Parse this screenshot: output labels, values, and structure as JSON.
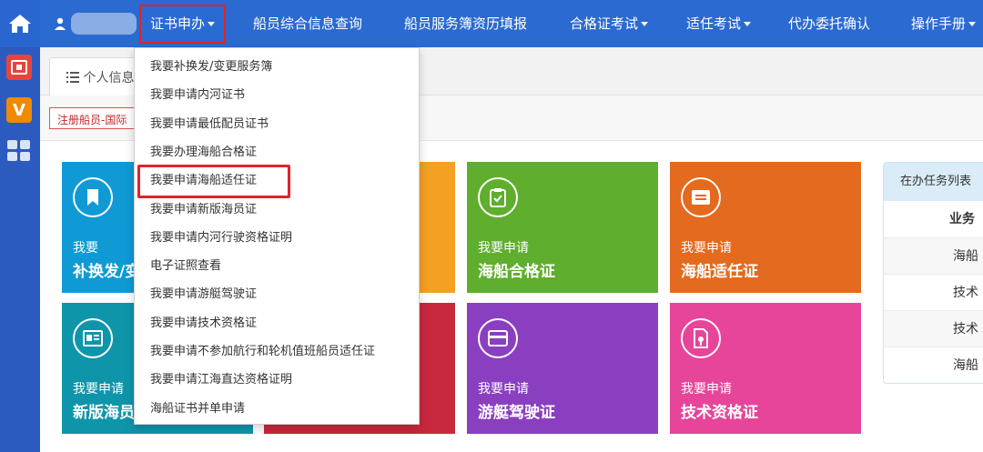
{
  "nav": {
    "items": [
      {
        "label": "证书申办",
        "caret": true
      },
      {
        "label": "船员综合信息查询",
        "caret": false
      },
      {
        "label": "船员服务簿资历填报",
        "caret": false
      },
      {
        "label": "合格证考试",
        "caret": true
      },
      {
        "label": "适任考试",
        "caret": true
      },
      {
        "label": "代办委托确认",
        "caret": false
      },
      {
        "label": "操作手册",
        "caret": true
      }
    ]
  },
  "tab": {
    "label": "个人信息"
  },
  "notice": {
    "text": "注册船员-国际"
  },
  "dropdown": {
    "items": [
      "我要补换发/变更服务簿",
      "我要申请内河证书",
      "我要申请最低配员证书",
      "我要办理海船合格证",
      "我要申请海船适任证",
      "我要申请新版海员证",
      "我要申请内河行驶资格证明",
      "电子证照查看",
      "我要申请游艇驾驶证",
      "我要申请技术资格证",
      "我要申请不参加航行和轮机值班船员适任证",
      "我要申请江海直达资格证明",
      "海船证书并单申请"
    ]
  },
  "tiles": [
    {
      "small": "我要",
      "big": "补换发/变",
      "icon": "bookmark-icon",
      "color": "#0f9ad6"
    },
    {
      "small": "",
      "big": "",
      "icon": "",
      "color": "#f4a023"
    },
    {
      "small": "我要申请",
      "big": "海船合格证",
      "icon": "clipboard-check-icon",
      "color": "#5fae2e"
    },
    {
      "small": "我要申请",
      "big": "海船适任证",
      "icon": "card-icon",
      "color": "#e46a1f"
    },
    {
      "small": "我要申请",
      "big": "新版海员",
      "icon": "id-card-icon",
      "color": "#0f95aa"
    },
    {
      "small": "",
      "big": "",
      "icon": "",
      "color": "#c8283c"
    },
    {
      "small": "我要申请",
      "big": "游艇驾驶证",
      "icon": "credit-card-icon",
      "color": "#8a3fc0"
    },
    {
      "small": "我要申请",
      "big": "技术资格证",
      "icon": "document-icon",
      "color": "#e7459a"
    }
  ],
  "task_panel": {
    "title": "在办任务列表",
    "column_header": "业务",
    "rows": [
      "海船",
      "技术",
      "技术",
      "海船"
    ]
  },
  "colors": {
    "nav_bg": "#2b6ad0",
    "rail_bg": "#2c5bc0",
    "highlight_red": "#e3222a"
  }
}
